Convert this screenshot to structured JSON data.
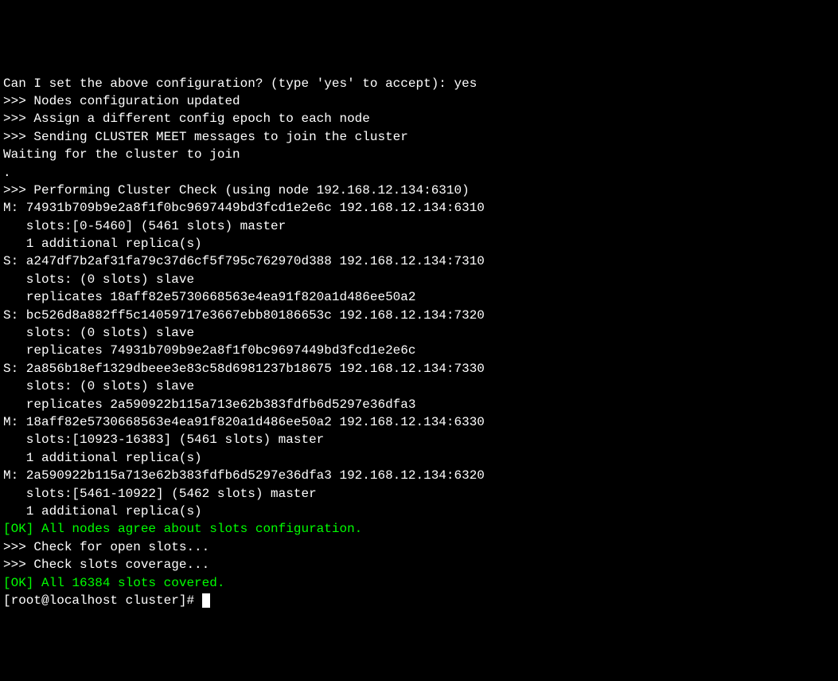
{
  "terminal": {
    "lines": [
      {
        "text": "Can I set the above configuration? (type 'yes' to accept): yes",
        "class": ""
      },
      {
        "text": ">>> Nodes configuration updated",
        "class": ""
      },
      {
        "text": ">>> Assign a different config epoch to each node",
        "class": ""
      },
      {
        "text": ">>> Sending CLUSTER MEET messages to join the cluster",
        "class": ""
      },
      {
        "text": "Waiting for the cluster to join",
        "class": ""
      },
      {
        "text": ".",
        "class": ""
      },
      {
        "text": ">>> Performing Cluster Check (using node 192.168.12.134:6310)",
        "class": ""
      },
      {
        "text": "M: 74931b709b9e2a8f1f0bc9697449bd3fcd1e2e6c 192.168.12.134:6310",
        "class": ""
      },
      {
        "text": "   slots:[0-5460] (5461 slots) master",
        "class": ""
      },
      {
        "text": "   1 additional replica(s)",
        "class": ""
      },
      {
        "text": "S: a247df7b2af31fa79c37d6cf5f795c762970d388 192.168.12.134:7310",
        "class": ""
      },
      {
        "text": "   slots: (0 slots) slave",
        "class": ""
      },
      {
        "text": "   replicates 18aff82e5730668563e4ea91f820a1d486ee50a2",
        "class": ""
      },
      {
        "text": "S: bc526d8a882ff5c14059717e3667ebb80186653c 192.168.12.134:7320",
        "class": ""
      },
      {
        "text": "   slots: (0 slots) slave",
        "class": ""
      },
      {
        "text": "   replicates 74931b709b9e2a8f1f0bc9697449bd3fcd1e2e6c",
        "class": ""
      },
      {
        "text": "S: 2a856b18ef1329dbeee3e83c58d6981237b18675 192.168.12.134:7330",
        "class": ""
      },
      {
        "text": "   slots: (0 slots) slave",
        "class": ""
      },
      {
        "text": "   replicates 2a590922b115a713e62b383fdfb6d5297e36dfa3",
        "class": ""
      },
      {
        "text": "M: 18aff82e5730668563e4ea91f820a1d486ee50a2 192.168.12.134:6330",
        "class": ""
      },
      {
        "text": "   slots:[10923-16383] (5461 slots) master",
        "class": ""
      },
      {
        "text": "   1 additional replica(s)",
        "class": ""
      },
      {
        "text": "M: 2a590922b115a713e62b383fdfb6d5297e36dfa3 192.168.12.134:6320",
        "class": ""
      },
      {
        "text": "   slots:[5461-10922] (5462 slots) master",
        "class": ""
      },
      {
        "text": "   1 additional replica(s)",
        "class": ""
      },
      {
        "text": "[OK] All nodes agree about slots configuration.",
        "class": "ok"
      },
      {
        "text": ">>> Check for open slots...",
        "class": ""
      },
      {
        "text": ">>> Check slots coverage...",
        "class": ""
      },
      {
        "text": "[OK] All 16384 slots covered.",
        "class": "ok"
      }
    ],
    "prompt": "[root@localhost cluster]# "
  }
}
